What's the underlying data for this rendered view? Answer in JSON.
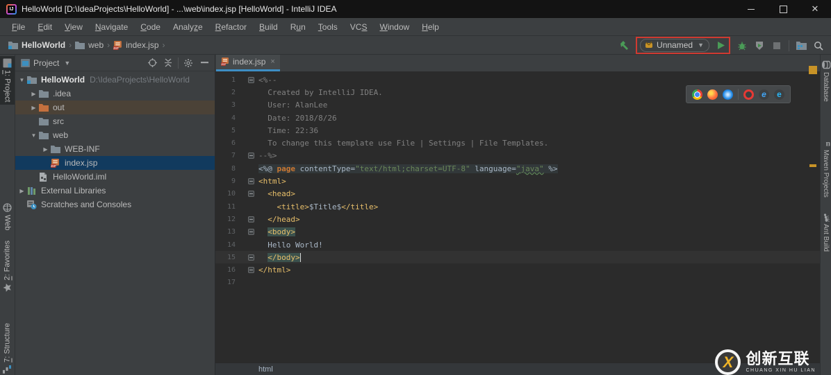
{
  "window": {
    "title": "HelloWorld [D:\\IdeaProjects\\HelloWorld] - ...\\web\\index.jsp [HelloWorld] - IntelliJ IDEA",
    "controls": {
      "minimize": "minimize",
      "maximize": "maximize",
      "close": "✕"
    }
  },
  "menu": {
    "items": [
      {
        "label": "File",
        "mnemonic": 0
      },
      {
        "label": "Edit",
        "mnemonic": 0
      },
      {
        "label": "View",
        "mnemonic": 0
      },
      {
        "label": "Navigate",
        "mnemonic": 0
      },
      {
        "label": "Code",
        "mnemonic": 0
      },
      {
        "label": "Analyze",
        "mnemonic": 5
      },
      {
        "label": "Refactor",
        "mnemonic": 0
      },
      {
        "label": "Build",
        "mnemonic": 0
      },
      {
        "label": "Run",
        "mnemonic": 1
      },
      {
        "label": "Tools",
        "mnemonic": 0
      },
      {
        "label": "VCS",
        "mnemonic": 2
      },
      {
        "label": "Window",
        "mnemonic": 0
      },
      {
        "label": "Help",
        "mnemonic": 0
      }
    ]
  },
  "navbar": {
    "breadcrumbs": [
      {
        "label": "HelloWorld",
        "icon": "project-folder",
        "bold": true
      },
      {
        "label": "web",
        "icon": "folder"
      },
      {
        "label": "index.jsp",
        "icon": "jsp-file"
      }
    ],
    "run_config": {
      "name": "Unnamed"
    }
  },
  "left_stripe": {
    "top": [
      {
        "label": "1: Project",
        "icon": "project",
        "active": true,
        "underline_first": true
      },
      {
        "label": "Web",
        "icon": "globe"
      }
    ],
    "bottom": [
      {
        "label": "2: Favorites",
        "icon": "star",
        "underline_first": true
      },
      {
        "label": "7: Structure",
        "icon": "structure",
        "underline_first": true
      }
    ]
  },
  "right_stripe": [
    {
      "label": "Database",
      "icon": "database"
    },
    {
      "label": "Maven Projects",
      "icon": "maven"
    },
    {
      "label": "Ant Build",
      "icon": "ant"
    }
  ],
  "project_panel": {
    "title": "Project",
    "tree": [
      {
        "depth": 0,
        "arrow": "down",
        "icon": "project-folder",
        "label": "HelloWorld",
        "bold": true,
        "extra": "D:\\IdeaProjects\\HelloWorld"
      },
      {
        "depth": 1,
        "arrow": "right",
        "icon": "folder",
        "label": ".idea"
      },
      {
        "depth": 1,
        "arrow": "right",
        "icon": "folder-excluded",
        "label": "out",
        "state": "hovered"
      },
      {
        "depth": 1,
        "arrow": "none",
        "icon": "folder",
        "label": "src"
      },
      {
        "depth": 1,
        "arrow": "down",
        "icon": "folder",
        "label": "web"
      },
      {
        "depth": 2,
        "arrow": "right",
        "icon": "folder",
        "label": "WEB-INF"
      },
      {
        "depth": 2,
        "arrow": "none",
        "icon": "jsp-file",
        "label": "index.jsp",
        "state": "selected"
      },
      {
        "depth": 1,
        "arrow": "none",
        "icon": "iml-file",
        "label": "HelloWorld.iml"
      },
      {
        "depth": 0,
        "arrow": "right",
        "icon": "libraries",
        "label": "External Libraries"
      },
      {
        "depth": 0,
        "arrow": "none",
        "icon": "scratches",
        "label": "Scratches and Consoles"
      }
    ]
  },
  "editor": {
    "tab": {
      "label": "index.jsp",
      "close": "×"
    },
    "bottom_breadcrumb": "html",
    "browser_icons": [
      "chrome",
      "firefox",
      "safari",
      "opera",
      "internet-explorer",
      "edge"
    ],
    "lines": [
      {
        "n": 1,
        "fold": true,
        "tokens": [
          [
            "<%--",
            "cm"
          ]
        ]
      },
      {
        "n": 2,
        "vline": true,
        "tokens": [
          [
            "  Created by IntelliJ IDEA.",
            "cm"
          ]
        ]
      },
      {
        "n": 3,
        "vline": true,
        "tokens": [
          [
            "  User: AlanLee",
            "cm"
          ]
        ]
      },
      {
        "n": 4,
        "vline": true,
        "tokens": [
          [
            "  Date: 2018/8/26",
            "cm"
          ]
        ]
      },
      {
        "n": 5,
        "vline": true,
        "tokens": [
          [
            "  Time: 22:36",
            "cm"
          ]
        ]
      },
      {
        "n": 6,
        "vline": true,
        "tokens": [
          [
            "  To change this template use File | Settings | File Templates.",
            "cm"
          ]
        ]
      },
      {
        "n": 7,
        "fold": true,
        "tokens": [
          [
            "--%>",
            "cm"
          ]
        ]
      },
      {
        "n": 8,
        "directive": true,
        "tokens": [
          [
            "<%@ ",
            "tx"
          ],
          [
            "page",
            "kw"
          ],
          [
            " contentType=",
            "tx"
          ],
          [
            "\"text/html;charset=UTF-8\"",
            "st"
          ],
          [
            " language=",
            "tx"
          ],
          [
            "\"java\"",
            "st",
            false,
            true
          ],
          [
            " %>",
            "tx"
          ]
        ]
      },
      {
        "n": 9,
        "fold": true,
        "tokens": [
          [
            "<html>",
            "tg"
          ]
        ]
      },
      {
        "n": 10,
        "fold": true,
        "tokens": [
          [
            "  <head>",
            "tg"
          ]
        ]
      },
      {
        "n": 11,
        "vline": true,
        "tokens": [
          [
            "    <title>",
            "tg"
          ],
          [
            "$Title$",
            "tx"
          ],
          [
            "</title>",
            "tg"
          ]
        ]
      },
      {
        "n": 12,
        "fold": true,
        "tokens": [
          [
            "  </head>",
            "tg"
          ]
        ]
      },
      {
        "n": 13,
        "fold": true,
        "tokens": [
          [
            "  ",
            "tx"
          ],
          [
            "<body>",
            "tg",
            true
          ]
        ]
      },
      {
        "n": 14,
        "vline": true,
        "tokens": [
          [
            "  Hello World!",
            "tx"
          ]
        ]
      },
      {
        "n": 15,
        "fold": true,
        "current": true,
        "caret": true,
        "tokens": [
          [
            "  ",
            "tx"
          ],
          [
            "</body>",
            "tg",
            true
          ]
        ]
      },
      {
        "n": 16,
        "fold": true,
        "tokens": [
          [
            "</html>",
            "tg"
          ]
        ]
      },
      {
        "n": 17,
        "tokens": []
      }
    ]
  },
  "watermark": {
    "logo_letter": "X",
    "cn": "创新互联",
    "en": "CHUANG XIN HU LIAN"
  },
  "colors": {
    "editor_bg": "#2b2b2b",
    "panel_bg": "#3c3f41",
    "selection_blue": "#113a5e",
    "hover_brown": "#4b4237",
    "tab_underline": "#3d8dc4",
    "tag_yellow": "#e8bf6a",
    "keyword_orange": "#cc7832",
    "string_green": "#6a8759",
    "comment_gray": "#808080",
    "run_green": "#499c54",
    "annotation_red": "#cf3a31",
    "marker_orange": "#c89327"
  }
}
